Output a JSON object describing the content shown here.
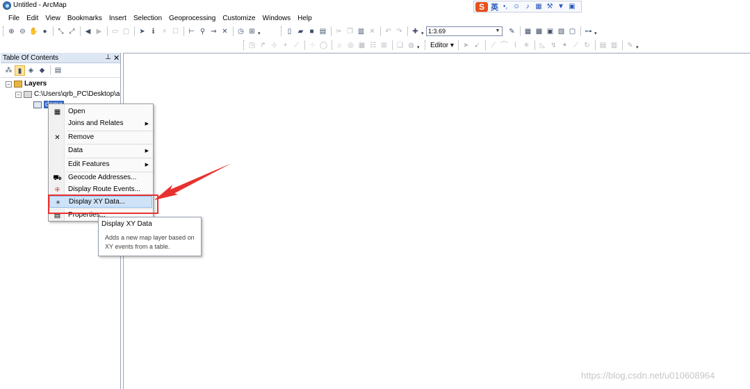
{
  "window": {
    "title": "Untitled - ArcMap"
  },
  "ime_bar": {
    "mode_label": "英"
  },
  "menubar": {
    "items": [
      "File",
      "Edit",
      "View",
      "Bookmarks",
      "Insert",
      "Selection",
      "Geoprocessing",
      "Customize",
      "Windows",
      "Help"
    ]
  },
  "toolbar": {
    "scale_value": "1:3.69",
    "editor_label": "Editor"
  },
  "toc": {
    "title": "Table Of Contents",
    "tree": {
      "root_label": "Layers",
      "folder_label": "C:\\Users\\qrb_PC\\Desktop\\a",
      "table_label": "demo"
    }
  },
  "context_menu": {
    "items": [
      {
        "label": "Open",
        "icon": "table-icon",
        "submenu": false
      },
      {
        "label": "Joins and Relates",
        "icon": "",
        "submenu": true
      },
      {
        "label": "Remove",
        "icon": "close-icon",
        "submenu": false
      },
      {
        "label": "Data",
        "icon": "",
        "submenu": true
      },
      {
        "label": "Edit Features",
        "icon": "",
        "submenu": true
      },
      {
        "label": "Geocode Addresses...",
        "icon": "geocode-icon",
        "submenu": false
      },
      {
        "label": "Display Route Events...",
        "icon": "route-events-icon",
        "submenu": false
      },
      {
        "label": "Display XY Data...",
        "icon": "xy-data-icon",
        "submenu": false,
        "highlighted": true
      },
      {
        "label": "Properties...",
        "icon": "properties-icon",
        "submenu": false
      }
    ]
  },
  "tooltip": {
    "title": "Display XY Data",
    "description": "Adds a new map layer based on XY events from a table."
  },
  "watermark": "https://blog.csdn.net/u010608964",
  "colors": {
    "highlight_red": "#e8312f",
    "selection_blue": "#3165c4",
    "menu_highlight": "#cfe3f8"
  }
}
